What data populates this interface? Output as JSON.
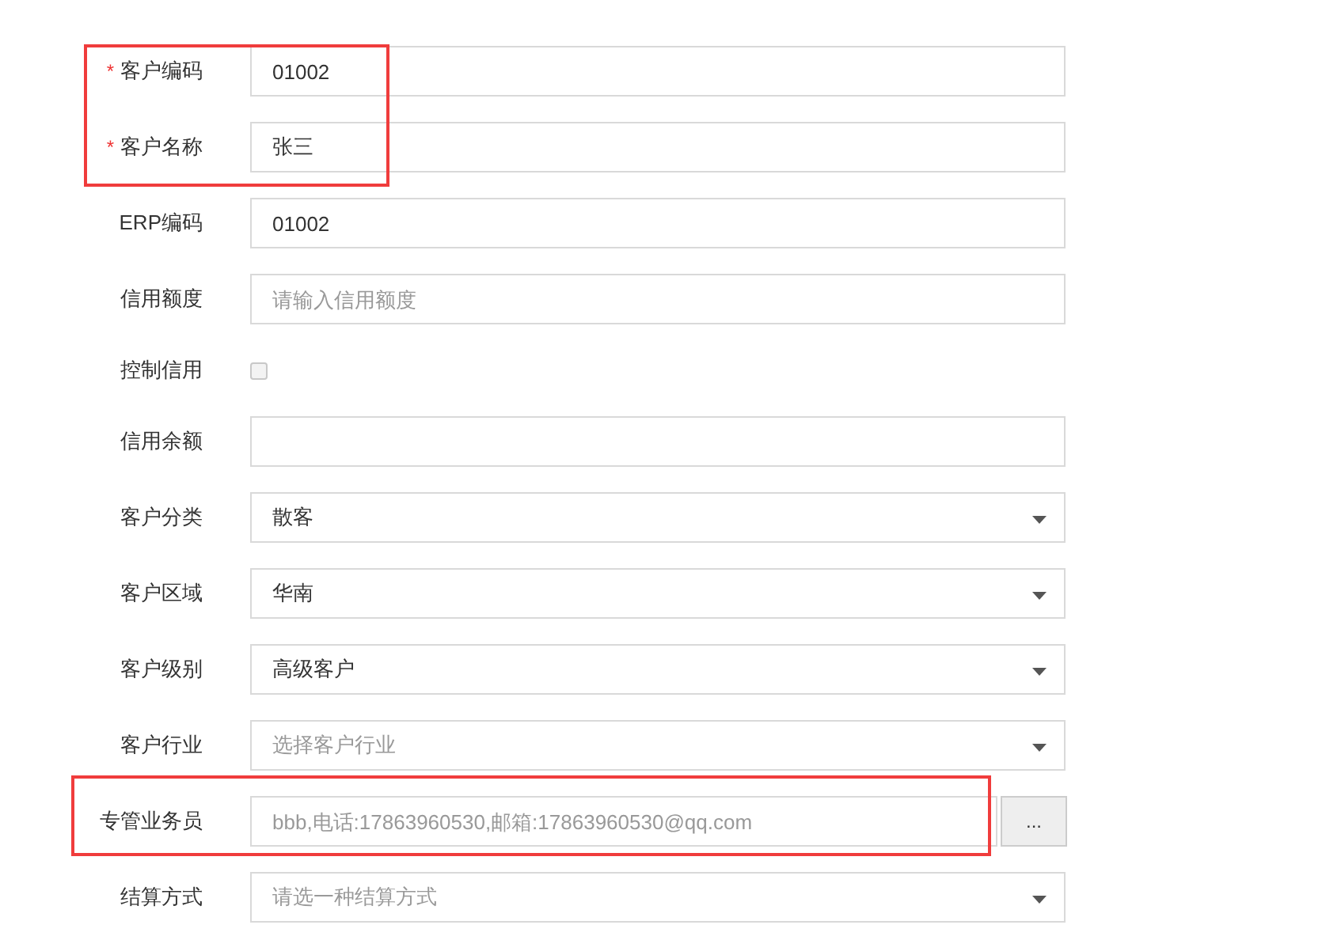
{
  "fields": [
    {
      "kind": "text",
      "label": "客户编码",
      "required_mark": "*",
      "highlighted": true,
      "value": "01002"
    },
    {
      "kind": "text",
      "label": "客户名称",
      "required_mark": "*",
      "highlighted": true,
      "value": "张三"
    },
    {
      "kind": "text",
      "label": "ERP编码",
      "highlighted": false,
      "value": "01002"
    },
    {
      "kind": "text",
      "label": "信用额度",
      "highlighted": false,
      "placeholder": "请输入信用额度"
    },
    {
      "kind": "checkbox",
      "label": "控制信用",
      "highlighted": false,
      "checked": false
    },
    {
      "kind": "text",
      "label": "信用余额",
      "highlighted": false
    },
    {
      "kind": "select",
      "label": "客户分类",
      "highlighted": false,
      "value": "散客"
    },
    {
      "kind": "select",
      "label": "客户区域",
      "highlighted": false,
      "value": "华南"
    },
    {
      "kind": "select",
      "label": "客户级别",
      "highlighted": false,
      "value": "高级客户"
    },
    {
      "kind": "select",
      "label": "客户行业",
      "highlighted": false,
      "placeholder": "选择客户行业"
    },
    {
      "kind": "lookup",
      "label": "专管业务员",
      "highlighted": true,
      "placeholder": "bbb,电话:17863960530,邮箱:17863960530@qq.com",
      "button": "..."
    },
    {
      "kind": "select",
      "label": "结算方式",
      "highlighted": false,
      "placeholder": "请选一种结算方式"
    }
  ]
}
